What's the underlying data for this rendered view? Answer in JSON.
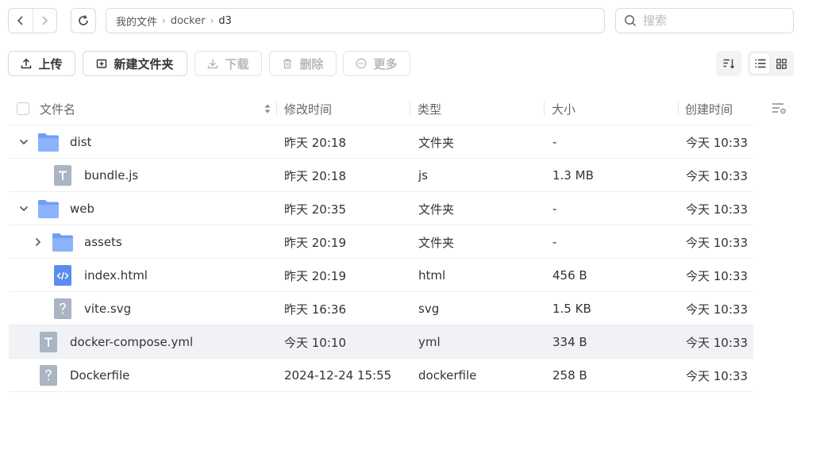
{
  "nav": {
    "back_icon": "chevron-left-icon",
    "forward_icon": "chevron-right-icon",
    "refresh_icon": "refresh-icon"
  },
  "breadcrumb": [
    "我的文件",
    "docker",
    "d3"
  ],
  "search": {
    "placeholder": "搜索",
    "value": ""
  },
  "toolbar": {
    "upload": "上传",
    "new_folder": "新建文件夹",
    "download": "下载",
    "delete": "删除",
    "more": "更多"
  },
  "columns": {
    "name": "文件名",
    "modified": "修改时间",
    "type": "类型",
    "size": "大小",
    "created": "创建时间"
  },
  "rows": [
    {
      "name": "dist",
      "modified": "昨天 20:18",
      "type": "文件夹",
      "size": "-",
      "created": "今天 10:33",
      "kind": "folder",
      "depth": 0,
      "expander": "chevron-down-icon"
    },
    {
      "name": "bundle.js",
      "modified": "昨天 20:18",
      "type": "js",
      "size": "1.3 MB",
      "created": "今天 10:33",
      "kind": "text",
      "depth": 1,
      "expander": ""
    },
    {
      "name": "web",
      "modified": "昨天 20:35",
      "type": "文件夹",
      "size": "-",
      "created": "今天 10:33",
      "kind": "folder",
      "depth": 0,
      "expander": "chevron-down-icon"
    },
    {
      "name": "assets",
      "modified": "昨天 20:19",
      "type": "文件夹",
      "size": "-",
      "created": "今天 10:33",
      "kind": "folder",
      "depth": 1,
      "expander": "chevron-right-icon"
    },
    {
      "name": "index.html",
      "modified": "昨天 20:19",
      "type": "html",
      "size": "456 B",
      "created": "今天 10:33",
      "kind": "code",
      "depth": 1,
      "expander": ""
    },
    {
      "name": "vite.svg",
      "modified": "昨天 16:36",
      "type": "svg",
      "size": "1.5 KB",
      "created": "今天 10:33",
      "kind": "unknown",
      "depth": 1,
      "expander": ""
    },
    {
      "name": "docker-compose.yml",
      "modified": "今天 10:10",
      "type": "yml",
      "size": "334 B",
      "created": "今天 10:33",
      "kind": "text",
      "depth": 0,
      "expander": "",
      "highlighted": true
    },
    {
      "name": "Dockerfile",
      "modified": "2024-12-24 15:55",
      "type": "dockerfile",
      "size": "258 B",
      "created": "今天 10:33",
      "kind": "unknown",
      "depth": 0,
      "expander": ""
    }
  ],
  "colors": {
    "folder": "#6f9ef5",
    "file_gray": "#aab4c2",
    "code_blue": "#5b8def",
    "highlight": "#f0f2f5"
  }
}
